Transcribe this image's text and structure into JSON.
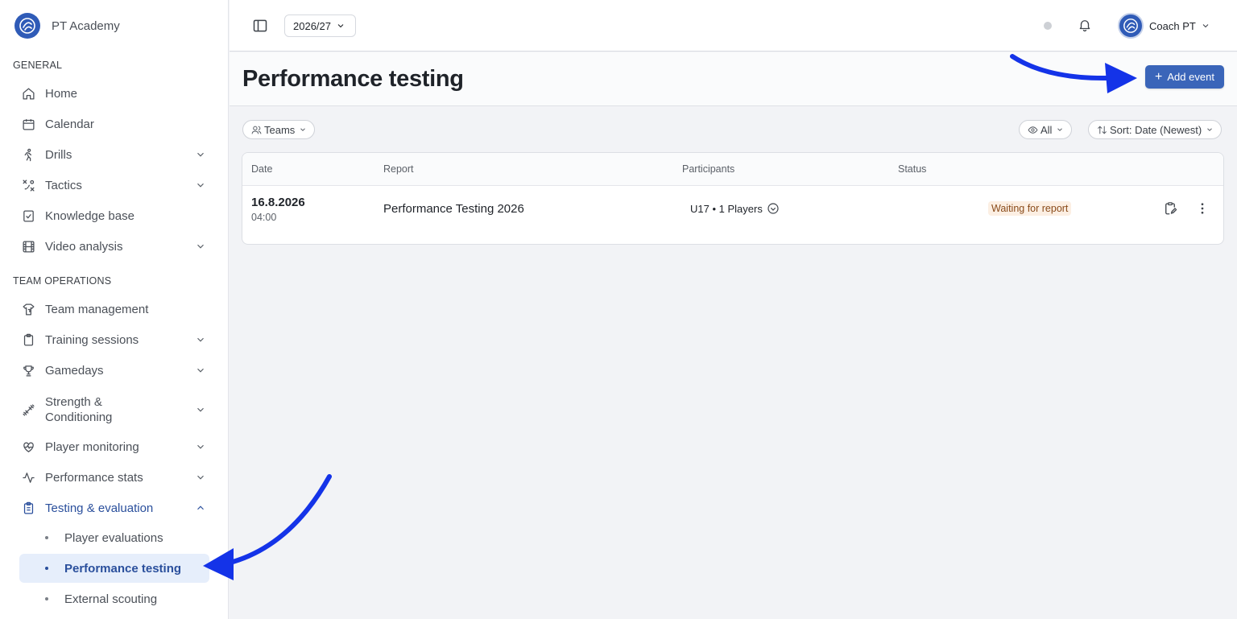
{
  "brand": {
    "name": "PT Academy"
  },
  "sidebar": {
    "sections": [
      {
        "label": "GENERAL"
      },
      {
        "label": "TEAM OPERATIONS"
      }
    ],
    "items": [
      {
        "label": "Home"
      },
      {
        "label": "Calendar"
      },
      {
        "label": "Drills"
      },
      {
        "label": "Tactics"
      },
      {
        "label": "Knowledge base"
      },
      {
        "label": "Video analysis"
      },
      {
        "label": "Team management"
      },
      {
        "label": "Training sessions"
      },
      {
        "label": "Gamedays"
      },
      {
        "label": "Strength & Conditioning"
      },
      {
        "label": "Player monitoring"
      },
      {
        "label": "Performance stats"
      },
      {
        "label": "Testing & evaluation"
      }
    ],
    "subitems": [
      {
        "label": "Player evaluations"
      },
      {
        "label": "Performance testing"
      },
      {
        "label": "External scouting"
      }
    ]
  },
  "topbar": {
    "season": "2026/27",
    "user": "Coach PT"
  },
  "page": {
    "title": "Performance testing",
    "add_button": "Add event"
  },
  "filters": {
    "teams": "Teams",
    "visibility": "All",
    "sort": "Sort: Date (Newest)"
  },
  "table": {
    "columns": [
      "Date",
      "Report",
      "Participants",
      "Status"
    ],
    "rows": [
      {
        "date": "16.8.2026",
        "time": "04:00",
        "report": "Performance Testing 2026",
        "participants": "U17 • 1 Players",
        "status": "Waiting for report"
      }
    ]
  },
  "colors": {
    "accent": "#3a65b9",
    "active_nav_bg": "#e6eefb",
    "status_badge_bg": "#fcefe3",
    "annotation_arrow": "#1433e8"
  }
}
